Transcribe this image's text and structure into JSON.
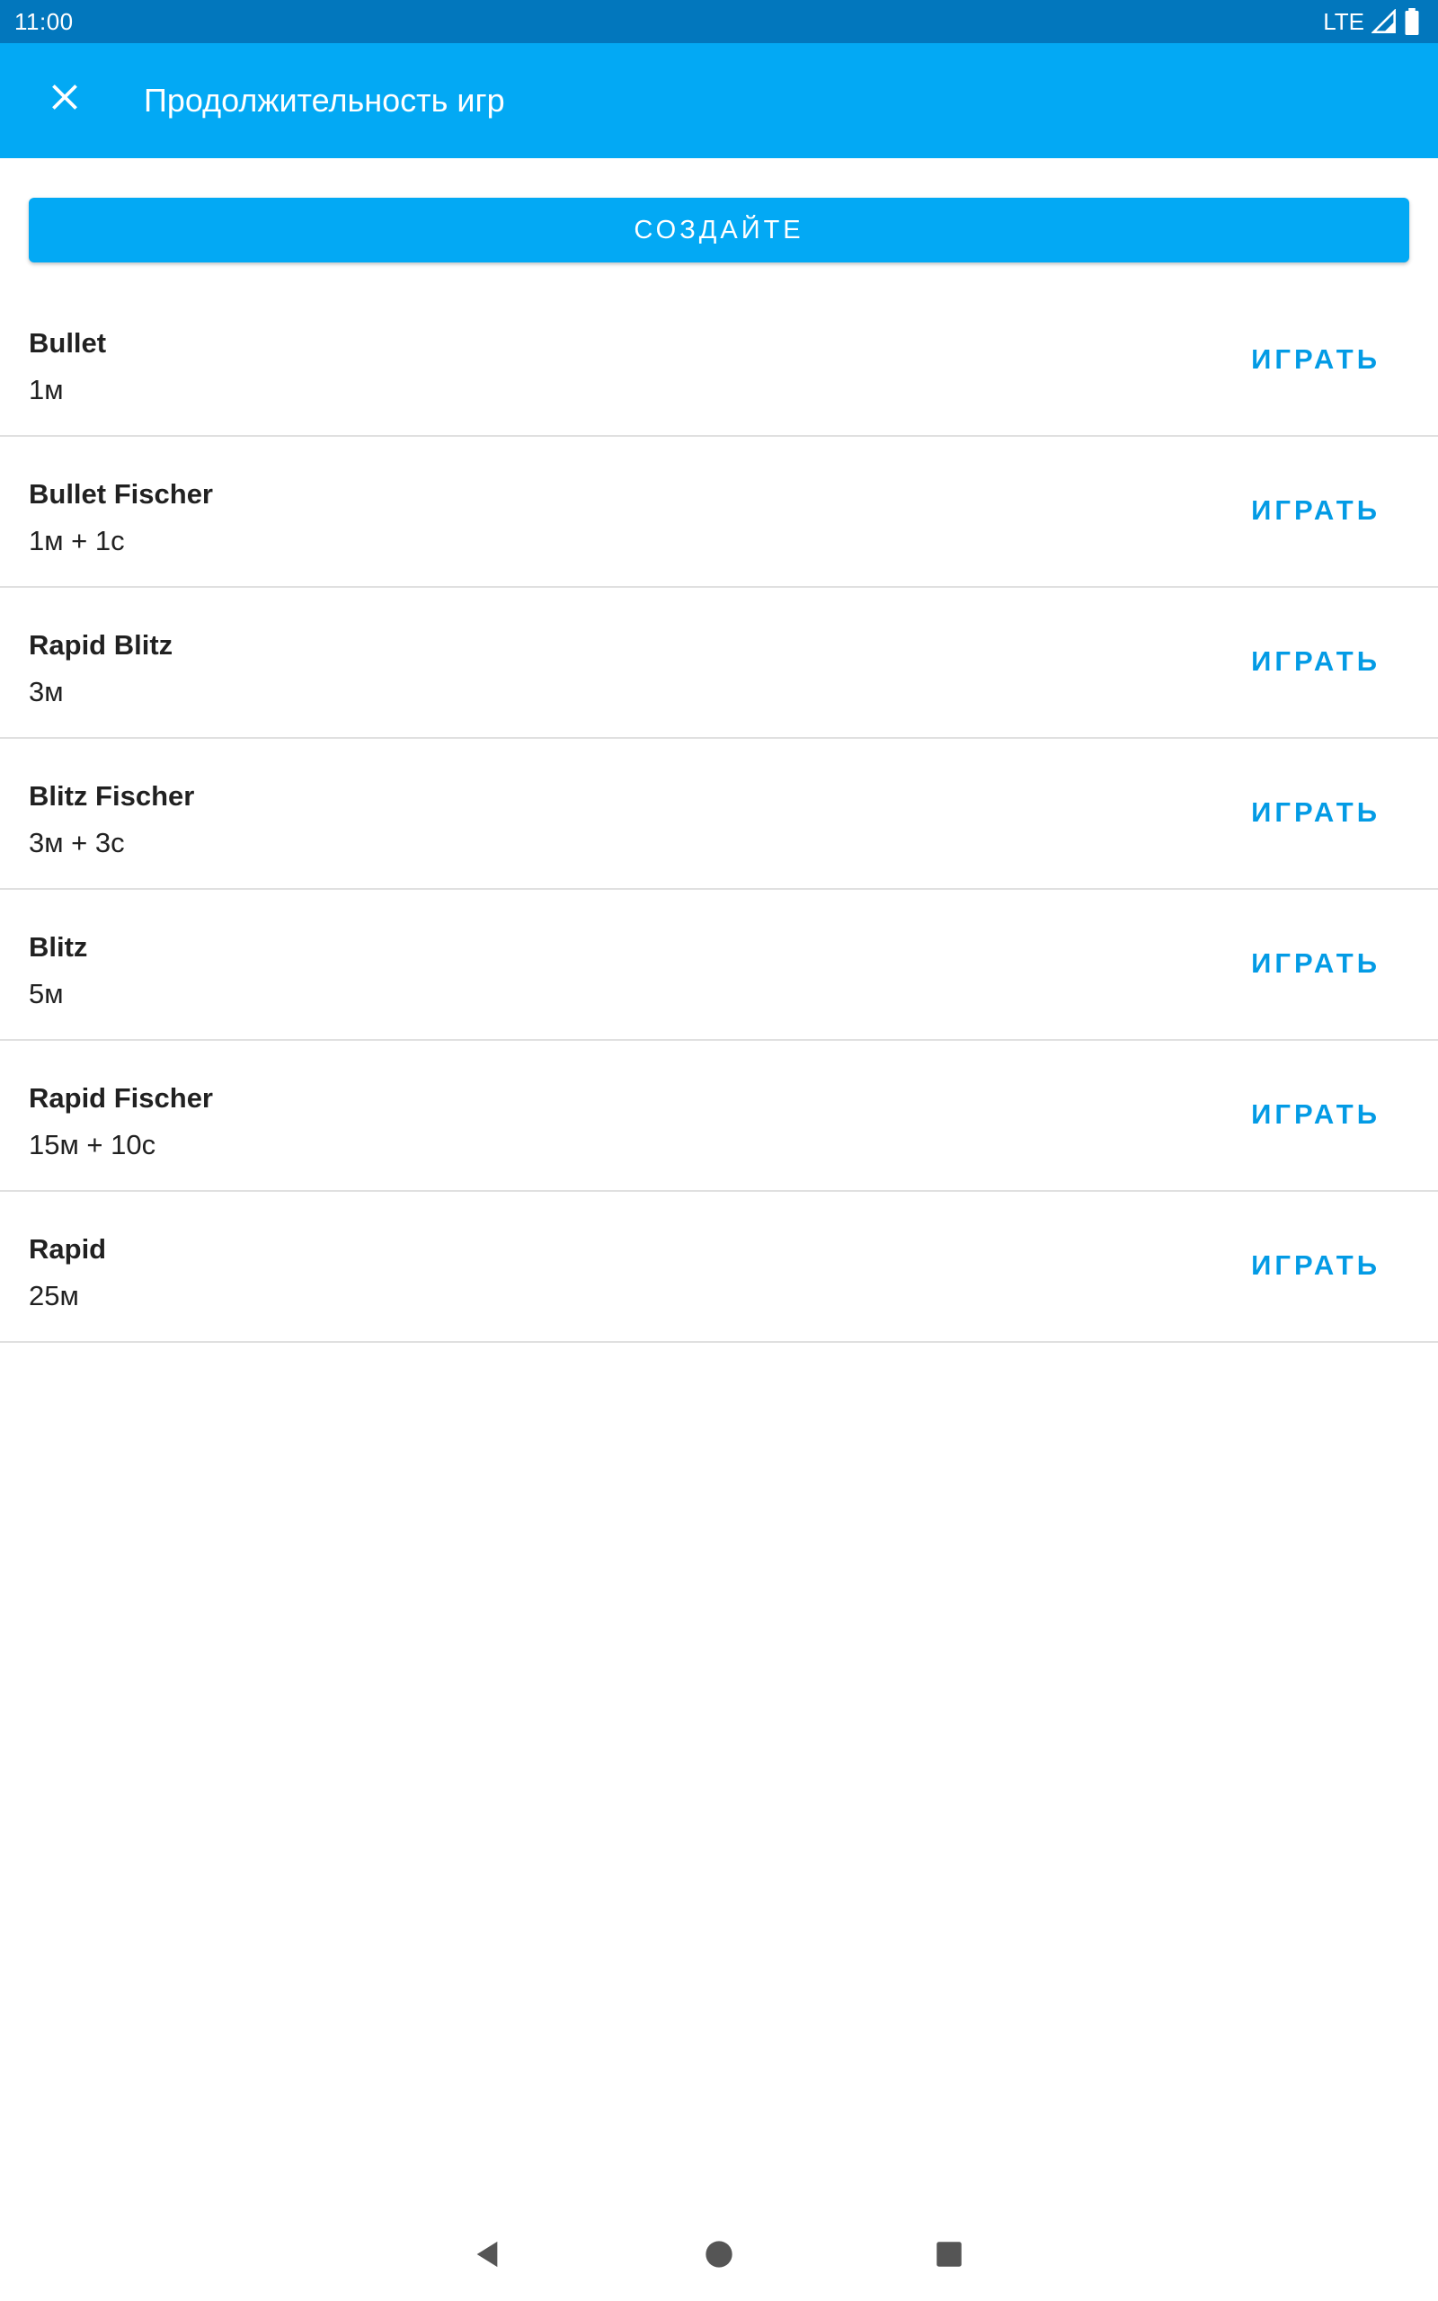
{
  "status_bar": {
    "time": "11:00",
    "network": "LTE",
    "icons": [
      "signal-icon",
      "battery-icon"
    ]
  },
  "app_bar": {
    "close_icon": "close-icon",
    "title": "Продолжительность игр"
  },
  "create_button": {
    "label": "СОЗДАЙТЕ"
  },
  "time_controls": [
    {
      "name": "Bullet",
      "time": "1м",
      "play_label": "ИГРАТЬ"
    },
    {
      "name": "Bullet Fischer",
      "time": "1м + 1с",
      "play_label": "ИГРАТЬ"
    },
    {
      "name": "Rapid Blitz",
      "time": "3м",
      "play_label": "ИГРАТЬ"
    },
    {
      "name": "Blitz Fischer",
      "time": "3м + 3с",
      "play_label": "ИГРАТЬ"
    },
    {
      "name": "Blitz",
      "time": "5м",
      "play_label": "ИГРАТЬ"
    },
    {
      "name": "Rapid Fischer",
      "time": "15м + 10с",
      "play_label": "ИГРАТЬ"
    },
    {
      "name": "Rapid",
      "time": "25м",
      "play_label": "ИГРАТЬ"
    }
  ],
  "nav_bar": {
    "icons": [
      "back-icon",
      "home-icon",
      "recents-icon"
    ]
  },
  "colors": {
    "status_bar": "#0277bd",
    "app_bar": "#03a9f4",
    "accent_text": "#039be5",
    "divider": "#e0e0e0"
  }
}
